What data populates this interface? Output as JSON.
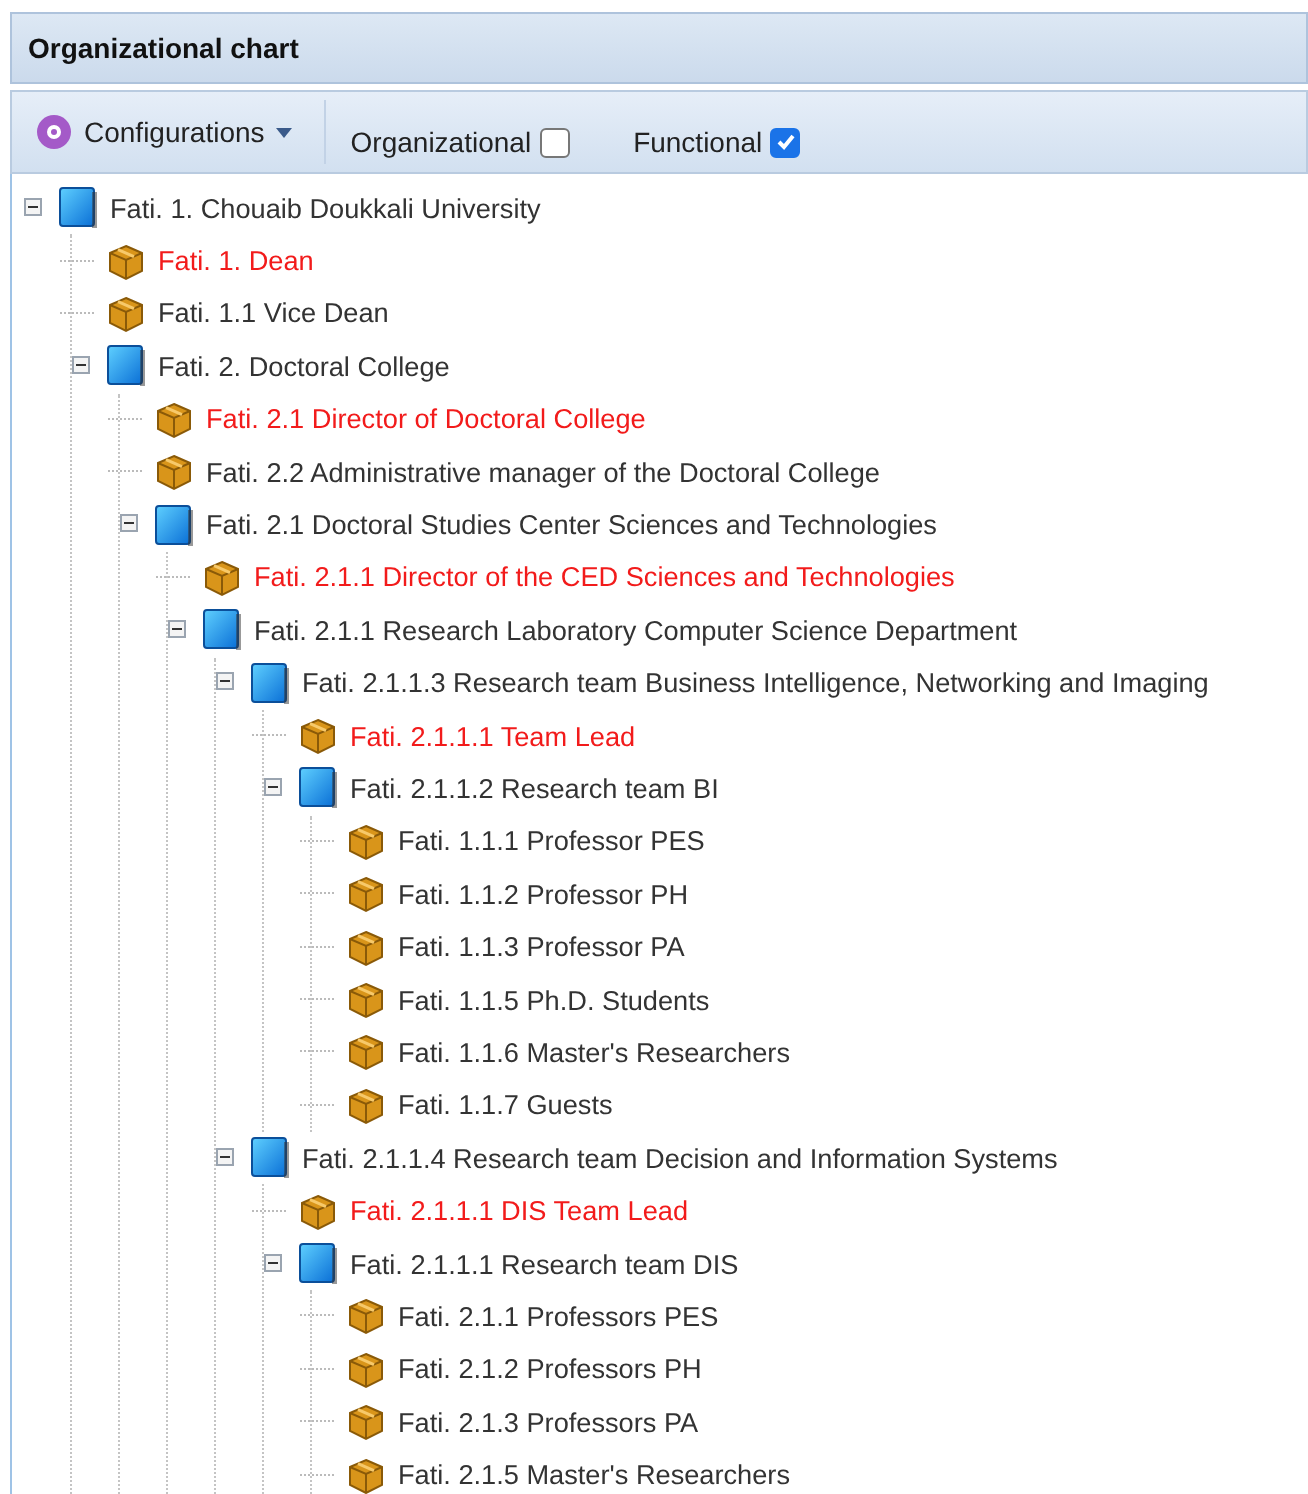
{
  "panel": {
    "title": "Organizational chart"
  },
  "toolbar": {
    "menu_button": "Configurations",
    "checkboxes": [
      {
        "label": "Organizational",
        "checked": false
      },
      {
        "label": "Functional",
        "checked": true
      }
    ]
  },
  "tree": [
    {
      "kind": "unit",
      "label": "Fati. 1. Chouaib Doukkali University",
      "highlighted": false,
      "expanded": true,
      "children": [
        {
          "kind": "post",
          "label": "Fati. 1. Dean",
          "highlighted": true
        },
        {
          "kind": "post",
          "label": "Fati. 1.1 Vice Dean",
          "highlighted": false
        },
        {
          "kind": "unit",
          "label": "Fati. 2. Doctoral College",
          "highlighted": false,
          "expanded": true,
          "children": [
            {
              "kind": "post",
              "label": "Fati. 2.1 Director of Doctoral College",
              "highlighted": true
            },
            {
              "kind": "post",
              "label": "Fati. 2.2 Administrative manager of the Doctoral College",
              "highlighted": false
            },
            {
              "kind": "unit",
              "label": "Fati. 2.1 Doctoral Studies Center Sciences and Technologies",
              "highlighted": false,
              "expanded": true,
              "children": [
                {
                  "kind": "post",
                  "label": "Fati. 2.1.1 Director of the CED Sciences and Technologies",
                  "highlighted": true
                },
                {
                  "kind": "unit",
                  "label": "Fati. 2.1.1 Research Laboratory Computer Science Department",
                  "highlighted": false,
                  "expanded": true,
                  "children": [
                    {
                      "kind": "unit",
                      "label": "Fati. 2.1.1.3 Research team Business Intelligence, Networking and Imaging",
                      "highlighted": false,
                      "expanded": true,
                      "children": [
                        {
                          "kind": "post",
                          "label": "Fati. 2.1.1.1 Team Lead",
                          "highlighted": true
                        },
                        {
                          "kind": "unit",
                          "label": "Fati. 2.1.1.2 Research team BI",
                          "highlighted": false,
                          "expanded": true,
                          "children": [
                            {
                              "kind": "post",
                              "label": "Fati. 1.1.1 Professor PES",
                              "highlighted": false
                            },
                            {
                              "kind": "post",
                              "label": "Fati. 1.1.2 Professor PH",
                              "highlighted": false
                            },
                            {
                              "kind": "post",
                              "label": "Fati. 1.1.3 Professor PA",
                              "highlighted": false
                            },
                            {
                              "kind": "post",
                              "label": "Fati. 1.1.5 Ph.D. Students",
                              "highlighted": false
                            },
                            {
                              "kind": "post",
                              "label": "Fati. 1.1.6 Master's Researchers",
                              "highlighted": false
                            },
                            {
                              "kind": "post",
                              "label": "Fati. 1.1.7 Guests",
                              "highlighted": false
                            }
                          ]
                        }
                      ]
                    },
                    {
                      "kind": "unit",
                      "label": "Fati. 2.1.1.4 Research team Decision and Information Systems",
                      "highlighted": false,
                      "expanded": true,
                      "children": [
                        {
                          "kind": "post",
                          "label": "Fati. 2.1.1.1 DIS Team Lead",
                          "highlighted": true
                        },
                        {
                          "kind": "unit",
                          "label": "Fati. 2.1.1.1 Research team DIS",
                          "highlighted": false,
                          "expanded": true,
                          "children": [
                            {
                              "kind": "post",
                              "label": "Fati. 2.1.1 Professors PES",
                              "highlighted": false
                            },
                            {
                              "kind": "post",
                              "label": "Fati. 2.1.2 Professors PH",
                              "highlighted": false
                            },
                            {
                              "kind": "post",
                              "label": "Fati. 2.1.3 Professors PA",
                              "highlighted": false
                            },
                            {
                              "kind": "post",
                              "label": "Fati. 2.1.5 Master's Researchers",
                              "highlighted": false
                            }
                          ]
                        }
                      ]
                    }
                  ]
                }
              ]
            }
          ]
        }
      ]
    }
  ]
}
